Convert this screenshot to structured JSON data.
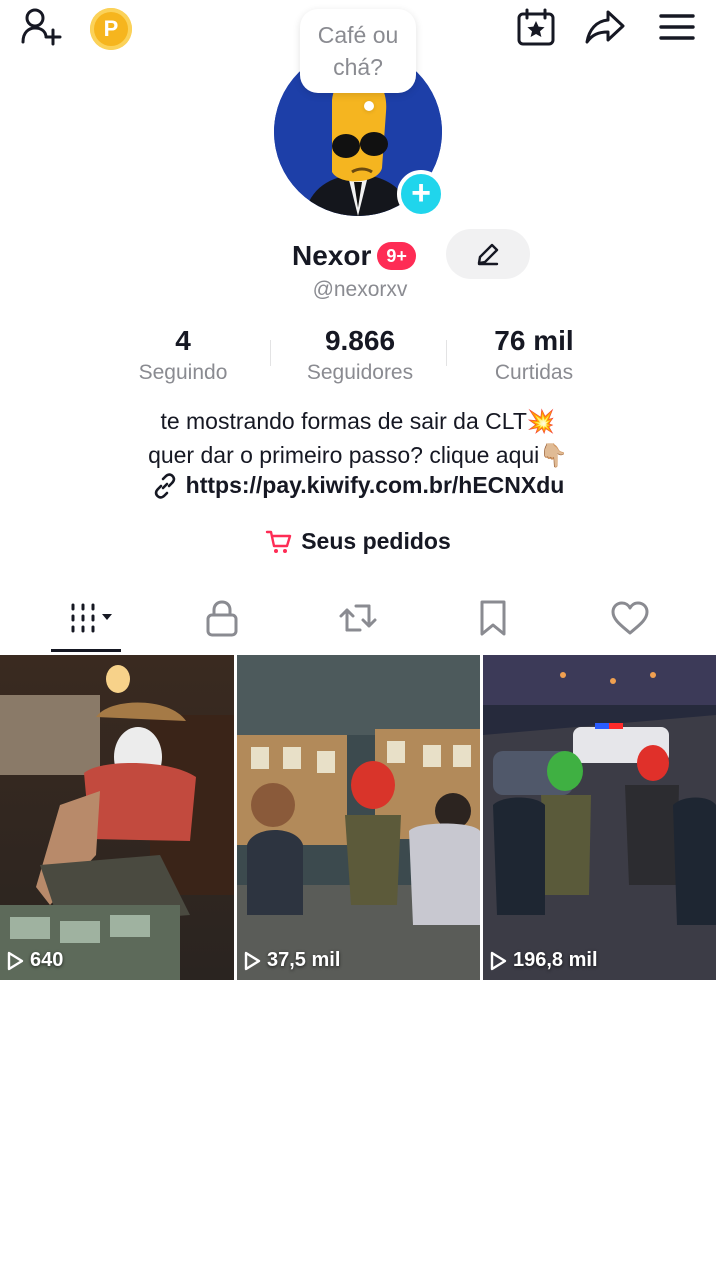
{
  "header": {
    "add_friend_icon": "person-add-icon",
    "points_badge": "P",
    "calendar_icon": "calendar-star-icon",
    "share_icon": "share-arrow-icon",
    "menu_icon": "hamburger-menu-icon"
  },
  "profile": {
    "note": "Café ou chá?",
    "add_story_icon": "plus-icon",
    "display_name": "Nexor",
    "notification_badge": "9+",
    "edit_icon": "pencil-icon",
    "username": "@nexorxv"
  },
  "stats": [
    {
      "value": "4",
      "label": "Seguindo"
    },
    {
      "value": "9.866",
      "label": "Seguidores"
    },
    {
      "value": "76 mil",
      "label": "Curtidas"
    }
  ],
  "bio": {
    "line1": "te mostrando formas de sair da CLT💥",
    "line2": "quer dar o primeiro passo? clique aqui👇🏼",
    "link": "https://pay.kiwify.com.br/hECNXdu"
  },
  "orders": {
    "label": "Seus pedidos",
    "icon": "shopping-cart-icon",
    "icon_color": "#fe2c55"
  },
  "tabs": [
    {
      "name": "videos",
      "icon": "grid-icon",
      "selected": true
    },
    {
      "name": "private",
      "icon": "lock-icon",
      "selected": false
    },
    {
      "name": "reposts",
      "icon": "repost-icon",
      "selected": false
    },
    {
      "name": "saved",
      "icon": "bookmark-icon",
      "selected": false
    },
    {
      "name": "liked",
      "icon": "heart-icon",
      "selected": false
    }
  ],
  "videos": [
    {
      "views": "640"
    },
    {
      "views": "37,5 mil"
    },
    {
      "views": "196,8 mil"
    }
  ],
  "colors": {
    "accent": "#fe2c55",
    "story_plus": "#20d5ec",
    "text_primary": "#161823",
    "text_secondary": "#8a8b91"
  }
}
